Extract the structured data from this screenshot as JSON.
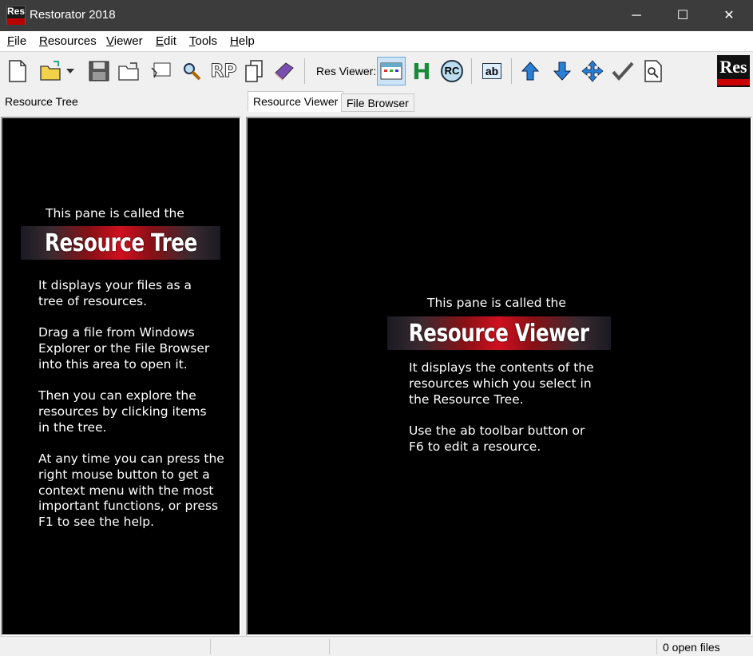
{
  "window": {
    "title": "Restorator 2018",
    "app_icon_text": "Res",
    "controls": {
      "minimize": "─",
      "maximize": "☐",
      "close": "✕"
    }
  },
  "menu": [
    {
      "label": "File",
      "accel": "F",
      "rest": "ile"
    },
    {
      "label": "Resources",
      "accel": "R",
      "rest": "esources"
    },
    {
      "label": "Viewer",
      "accel": "V",
      "rest": "iewer"
    },
    {
      "label": "Edit",
      "accel": "E",
      "rest": "dit"
    },
    {
      "label": "Tools",
      "accel": "T",
      "rest": "ools"
    },
    {
      "label": "Help",
      "accel": "H",
      "rest": "elp"
    }
  ],
  "toolbar": {
    "res_viewer_label": "Res Viewer:",
    "rp_label": "RP",
    "h_label": "H",
    "rc_label": "RC",
    "ab_label": "ab",
    "brand_text": "Res"
  },
  "panels": {
    "resource_tree_label": "Resource Tree",
    "tabs": [
      "Resource Viewer",
      "File Browser"
    ]
  },
  "left_pane": {
    "intro": "This pane is called the",
    "banner": "Resource Tree",
    "paragraphs": [
      "It displays your files as a\ntree of resources.",
      "Drag a file from Windows\nExplorer or the File Browser\ninto this area to open it.",
      "Then you can explore the\nresources by clicking items\nin the tree.",
      "At any time you can press the\nright mouse button to get a\ncontext menu with the most\nimportant functions, or press\nF1 to see the help."
    ]
  },
  "right_pane": {
    "intro": "This pane is called the",
    "banner": "Resource Viewer",
    "paragraphs": [
      "It displays the contents of the\nresources which you select in\nthe Resource Tree.",
      "Use the ab toolbar button or\nF6 to edit a resource."
    ]
  },
  "status": {
    "open_files": "0 open files"
  }
}
